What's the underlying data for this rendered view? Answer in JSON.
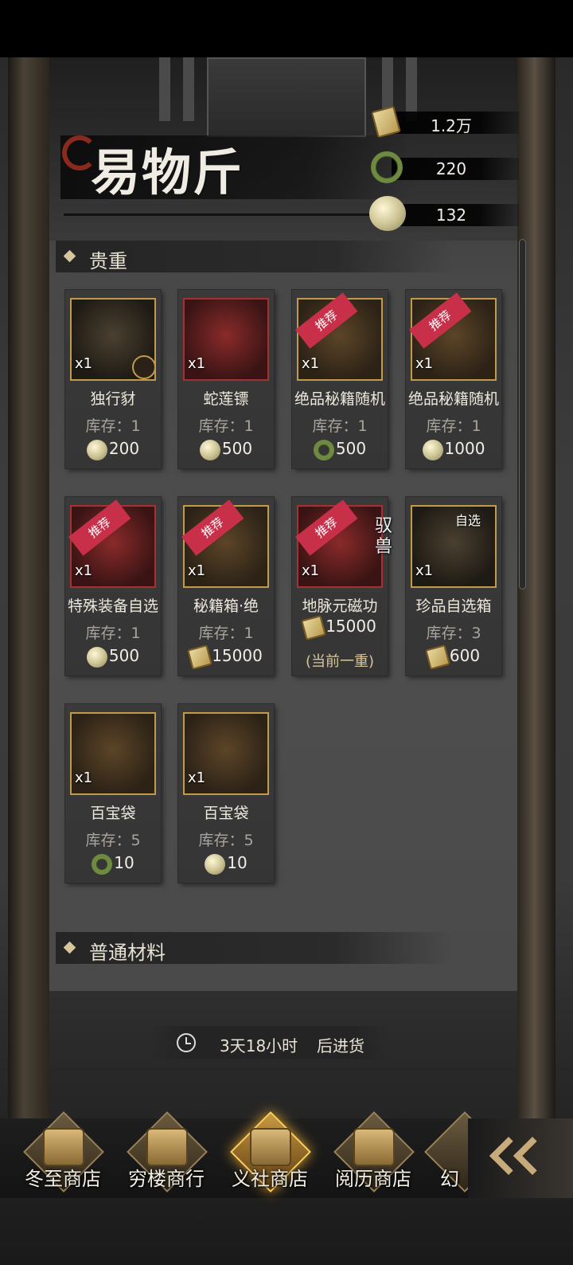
{
  "header": {
    "title": "易物斤",
    "currencies": [
      {
        "icon": "scroll-token-icon",
        "value": "1.2万"
      },
      {
        "icon": "jade-ring-icon",
        "value": "220"
      },
      {
        "icon": "pearl-icon",
        "value": "132"
      }
    ]
  },
  "sections": [
    {
      "label": "贵重"
    },
    {
      "label": "普通材料"
    }
  ],
  "items": [
    {
      "name": "独行豺",
      "qty": "x1",
      "stock": "库存：1",
      "price": "200",
      "currency": "pearl",
      "tag": ""
    },
    {
      "name": "蛇莲镖",
      "qty": "x1",
      "stock": "库存：1",
      "price": "500",
      "currency": "pearl",
      "tag": ""
    },
    {
      "name": "绝品秘籍随机",
      "qty": "x1",
      "stock": "库存：1",
      "price": "500",
      "currency": "jade",
      "tag": "推荐"
    },
    {
      "name": "绝品秘籍随机",
      "qty": "x1",
      "stock": "库存：1",
      "price": "1000",
      "currency": "pearl",
      "tag": "推荐"
    },
    {
      "name": "特殊装备自选",
      "qty": "x1",
      "stock": "库存：1",
      "price": "500",
      "currency": "pearl",
      "tag": "推荐"
    },
    {
      "name": "秘籍箱·绝",
      "qty": "x1",
      "stock": "库存：1",
      "price": "15000",
      "currency": "scroll",
      "tag": "推荐"
    },
    {
      "name": "地脉元磁功",
      "qty": "x1",
      "stock": "",
      "price": "15000",
      "currency": "scroll",
      "tag": "推荐",
      "side_label": "驭兽",
      "note": "(当前一重)"
    },
    {
      "name": "珍品自选箱",
      "qty": "x1",
      "stock": "库存：3",
      "price": "600",
      "currency": "scroll",
      "tag": "",
      "corner_label": "自选"
    },
    {
      "name": "百宝袋",
      "qty": "x1",
      "stock": "库存：5",
      "price": "10",
      "currency": "jade",
      "tag": ""
    },
    {
      "name": "百宝袋",
      "qty": "x1",
      "stock": "库存：5",
      "price": "10",
      "currency": "pearl",
      "tag": ""
    }
  ],
  "restock": {
    "time": "3天18小时",
    "suffix": "后进货"
  },
  "tabs": [
    {
      "label": "冬至商店",
      "active": false
    },
    {
      "label": "穷楼商行",
      "active": false
    },
    {
      "label": "义社商店",
      "active": true
    },
    {
      "label": "阅历商店",
      "active": false
    },
    {
      "label": "幻",
      "active": false
    }
  ]
}
